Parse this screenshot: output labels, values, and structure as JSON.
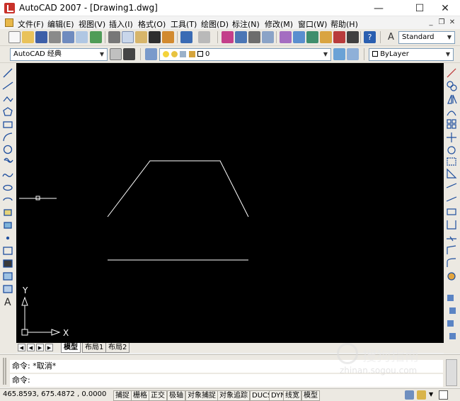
{
  "window": {
    "title": "AutoCAD 2007 - [Drawing1.dwg]"
  },
  "menu": {
    "items": [
      "文件(F)",
      "编辑(E)",
      "视图(V)",
      "插入(I)",
      "格式(O)",
      "工具(T)",
      "绘图(D)",
      "标注(N)",
      "修改(M)",
      "窗口(W)",
      "帮助(H)"
    ]
  },
  "toolbar": {
    "text_style": "Standard",
    "workspace": "AutoCAD 经典",
    "layer": "0",
    "color": "ByLayer"
  },
  "drawing": {
    "ucs_y": "Y",
    "ucs_x": "X"
  },
  "tabs": {
    "items": [
      "模型",
      "布局1",
      "布局2"
    ]
  },
  "command": {
    "line1": "命令: *取消*",
    "line2": "命令:"
  },
  "status": {
    "coords": "465.8593,  675.4872 , 0.0000",
    "toggles": [
      "捕捉",
      "栅格",
      "正交",
      "极轴",
      "对象捕捉",
      "对象追踪",
      "DUCS",
      "DYN",
      "线宽",
      "模型"
    ]
  },
  "watermark": {
    "text": "搜狗指南",
    "url": "zhinan.sogou.com"
  },
  "colors": {
    "canvas": "#000000",
    "lines": "#ffffff"
  }
}
